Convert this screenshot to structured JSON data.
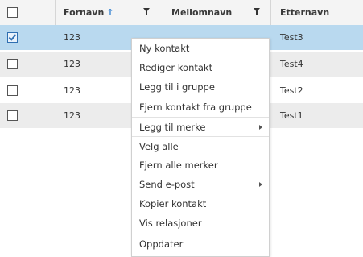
{
  "header": {
    "col1": "Fornavn",
    "col1_sort": "↑",
    "col2": "Mellomnavn",
    "col3": "Etternavn"
  },
  "rows": [
    {
      "first": "123",
      "last": "Test3",
      "checked": true
    },
    {
      "first": "123",
      "last": "Test4",
      "checked": false
    },
    {
      "first": "123",
      "last": "Test2",
      "checked": false
    },
    {
      "first": "123",
      "last": "Test1",
      "checked": false
    }
  ],
  "menu": {
    "items": [
      {
        "label": "Ny kontakt"
      },
      {
        "label": "Rediger kontakt"
      },
      {
        "label": "Legg til i gruppe"
      },
      {
        "label": "Fjern kontakt fra gruppe"
      },
      {
        "label": "Legg til merke",
        "submenu": true
      },
      {
        "label": "Velg alle"
      },
      {
        "label": "Fjern alle merker"
      },
      {
        "label": "Send e-post",
        "submenu": true
      },
      {
        "label": "Kopier kontakt"
      },
      {
        "label": "Vis relasjoner"
      },
      {
        "label": "Oppdater"
      }
    ]
  },
  "colors": {
    "selected_row": "#b9d9ef",
    "alt_row": "#ececec",
    "sort_arrow": "#2f7fd0"
  }
}
